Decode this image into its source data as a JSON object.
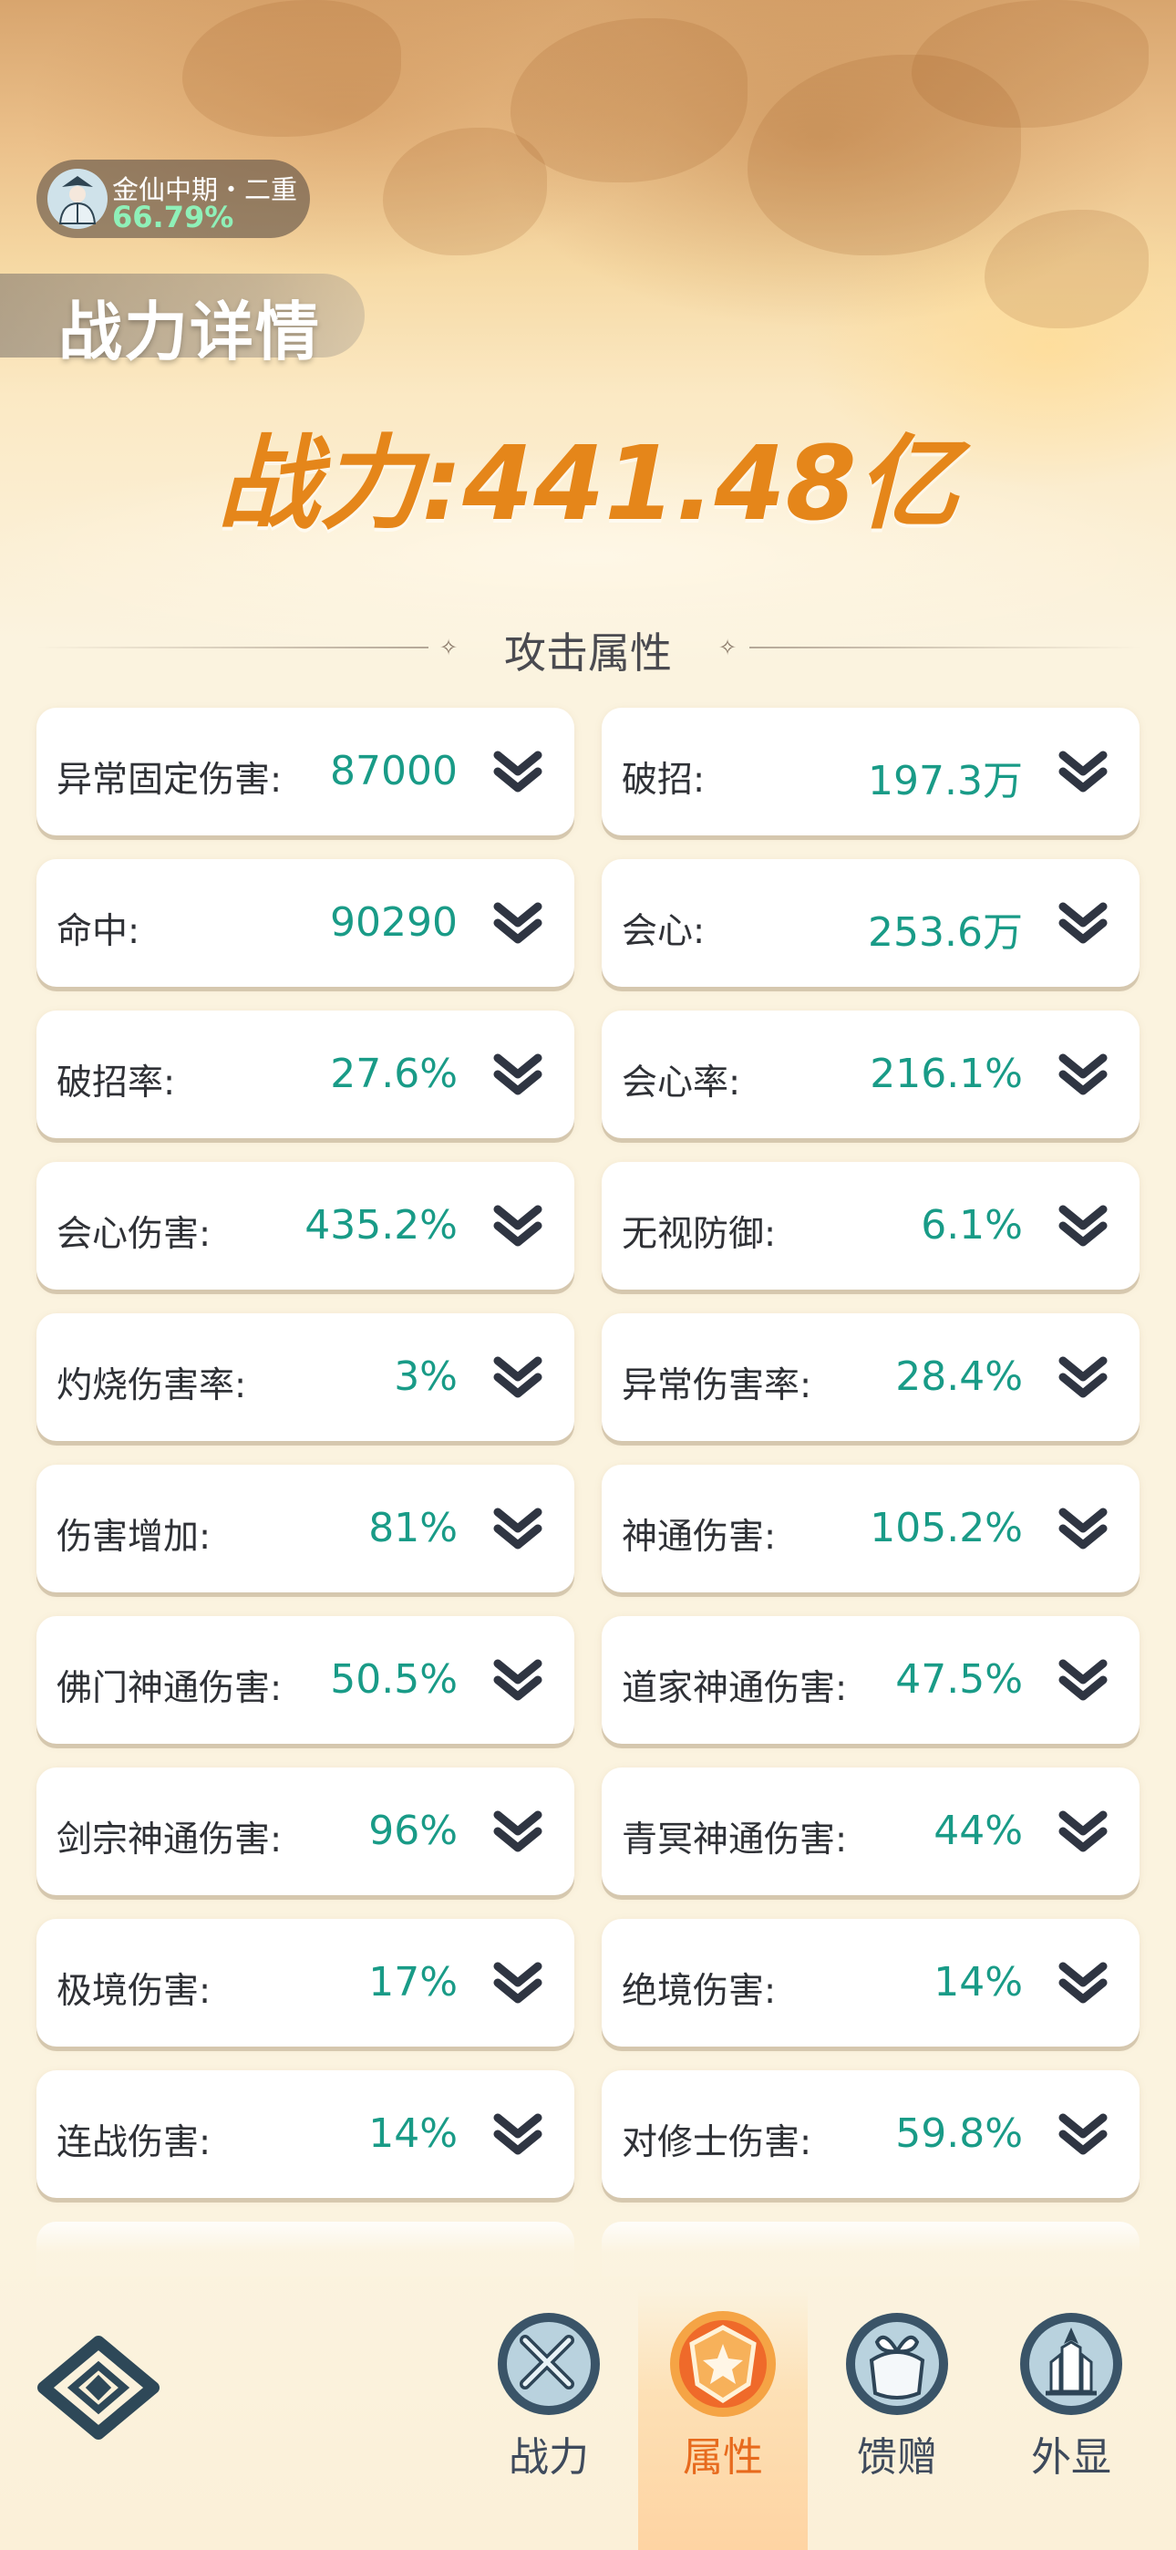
{
  "header": {
    "rank_name": "金仙中期・二重",
    "rank_progress": "66.79%",
    "page_title": "战力详情",
    "power_label": "战力:",
    "power_value": "441.48亿"
  },
  "section": {
    "title": "攻击属性"
  },
  "attributes": [
    {
      "label": "异常固定伤害:",
      "value": "87000"
    },
    {
      "label": "破招:",
      "value": "197.3万"
    },
    {
      "label": "命中:",
      "value": "90290"
    },
    {
      "label": "会心:",
      "value": "253.6万"
    },
    {
      "label": "破招率:",
      "value": "27.6%"
    },
    {
      "label": "会心率:",
      "value": "216.1%"
    },
    {
      "label": "会心伤害:",
      "value": "435.2%"
    },
    {
      "label": "无视防御:",
      "value": "6.1%"
    },
    {
      "label": "灼烧伤害率:",
      "value": "3%"
    },
    {
      "label": "异常伤害率:",
      "value": "28.4%"
    },
    {
      "label": "伤害增加:",
      "value": "81%"
    },
    {
      "label": "神通伤害:",
      "value": "105.2%"
    },
    {
      "label": "佛门神通伤害:",
      "value": "50.5%"
    },
    {
      "label": "道家神通伤害:",
      "value": "47.5%"
    },
    {
      "label": "剑宗神通伤害:",
      "value": "96%"
    },
    {
      "label": "青冥神通伤害:",
      "value": "44%"
    },
    {
      "label": "极境伤害:",
      "value": "17%"
    },
    {
      "label": "绝境伤害:",
      "value": "14%"
    },
    {
      "label": "连战伤害:",
      "value": "14%"
    },
    {
      "label": "对修士伤害:",
      "value": "59.8%"
    }
  ],
  "tabs": [
    {
      "label": "战力",
      "icon": "swords-icon",
      "active": false
    },
    {
      "label": "属性",
      "icon": "shield-star-icon",
      "active": true
    },
    {
      "label": "馈赠",
      "icon": "gift-icon",
      "active": false
    },
    {
      "label": "外显",
      "icon": "castle-icon",
      "active": false
    }
  ],
  "colors": {
    "value_teal": "#199b87",
    "power_orange": "#e5861a",
    "active_tab": "#e76a1d",
    "progress_green": "#8ff0b8"
  }
}
